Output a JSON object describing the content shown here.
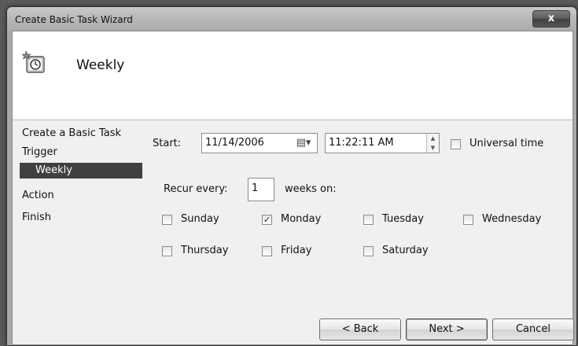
{
  "window": {
    "title": "Create Basic Task Wizard",
    "close_label": "x"
  },
  "header": {
    "title": "Weekly",
    "icon": "task-scheduler-clock-icon"
  },
  "nav": {
    "items": [
      {
        "label": "Create a Basic Task",
        "selected": false
      },
      {
        "label": "Trigger",
        "selected": false
      },
      {
        "label": "Weekly",
        "selected": true
      },
      {
        "label": "Action",
        "selected": false
      },
      {
        "label": "Finish",
        "selected": false
      }
    ]
  },
  "form": {
    "start_label": "Start:",
    "start_date": "11/14/2006",
    "date_picker_glyph": "▤▾",
    "start_time": "11:22:11 AM",
    "universal_time_label": "Universal time",
    "universal_time_checked": false,
    "recur_label": "Recur every:",
    "recur_value": "1",
    "weeks_on_label": "weeks on:",
    "days": [
      {
        "label": "Sunday",
        "checked": false
      },
      {
        "label": "Monday",
        "checked": true
      },
      {
        "label": "Tuesday",
        "checked": false
      },
      {
        "label": "Wednesday",
        "checked": false
      },
      {
        "label": "Thursday",
        "checked": false
      },
      {
        "label": "Friday",
        "checked": false
      },
      {
        "label": "Saturday",
        "checked": false
      }
    ],
    "check_glyph": "✓"
  },
  "buttons": {
    "back": "< Back",
    "next": "Next >",
    "cancel": "Cancel"
  }
}
